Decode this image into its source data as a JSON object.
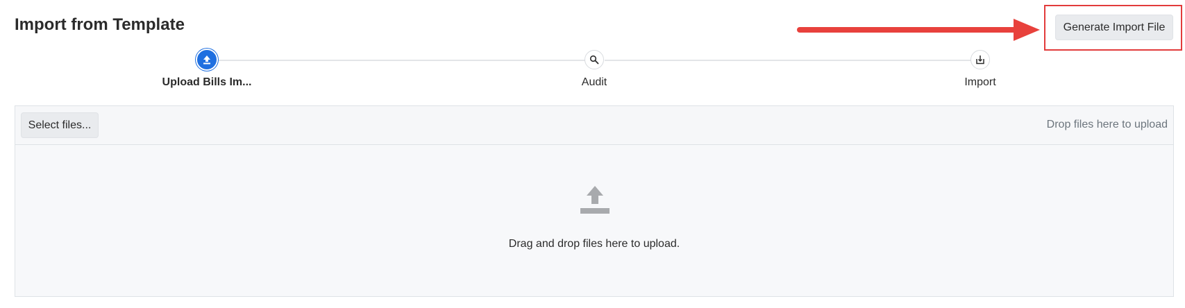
{
  "header": {
    "title": "Import from Template",
    "generate_button_label": "Generate Import File"
  },
  "annotation": {
    "arrow_color": "#e8413c",
    "highlight_color": "#e23b3b"
  },
  "stepper": {
    "steps": [
      {
        "label": "Upload Bills Im...",
        "icon": "upload-icon",
        "active": true
      },
      {
        "label": "Audit",
        "icon": "magnifier-icon",
        "active": false
      },
      {
        "label": "Import",
        "icon": "import-icon",
        "active": false
      }
    ],
    "active_color": "#1f6fe0"
  },
  "upload": {
    "select_files_label": "Select files...",
    "drop_hint": "Drop files here to upload",
    "drop_message": "Drag and drop files here to upload.",
    "icon": "upload-arrow-icon"
  }
}
